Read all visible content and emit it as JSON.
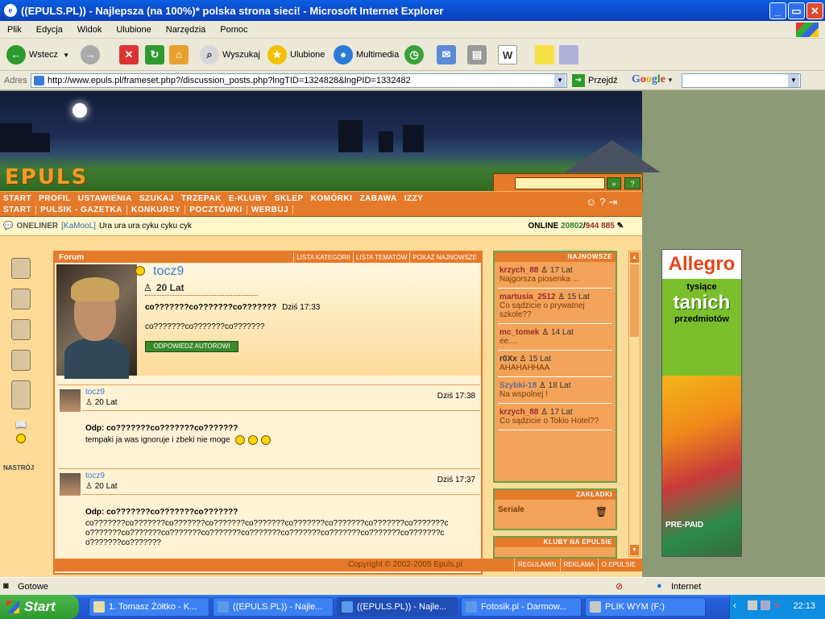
{
  "window": {
    "title": "((EPULS.PL)) - Najlepsza (na 100%)* polska strona sieci! - Microsoft Internet Explorer",
    "minimize": "_",
    "maximize": "▭",
    "close": "✕"
  },
  "menu": [
    "Plik",
    "Edycja",
    "Widok",
    "Ulubione",
    "Narzędzia",
    "Pomoc"
  ],
  "toolbar": {
    "back": "Wstecz",
    "search": "Wyszukaj",
    "favorites": "Ulubione",
    "media": "Multimedia"
  },
  "address": {
    "label": "Adres",
    "url": "http://www.epuls.pl/frameset.php?/discussion_posts.php?lngTID=1324828&lngPID=1332482",
    "go": "Przejdź",
    "google": "Google"
  },
  "site": {
    "logo": "EPULS",
    "nav_row1": [
      "Start",
      "Profil",
      "Ustawienia",
      "Szukaj",
      "Trzepak",
      "E-Kluby",
      "Sklep",
      "Komórki",
      "Zabawa",
      "Izzy"
    ],
    "nav_row2": [
      "Start",
      "Pulsik - Gazetka",
      "Konkursy",
      "Pocztówki",
      "Werbuj"
    ],
    "oneliner_label": "ONELINER",
    "oneliner_nick": "[KaMooL]",
    "oneliner_text": "Ura ura ura cyku cyku cyk",
    "online_label": "ONLINE",
    "online_count": "20802",
    "online_total": "944 885",
    "nastroj": "NASTRÓJ"
  },
  "forum": {
    "title": "Forum",
    "links": [
      "Lista kategorii",
      "Lista tematów",
      "Pokaż najnowsze"
    ],
    "main": {
      "user": "tocz9",
      "age": "20 Lat",
      "subject": "co???????co???????co???????",
      "date": "Dziś 17:33",
      "body": "co???????co???????co???????",
      "reply_btn": "ODPOWIEDZ AUTOROWI"
    },
    "replies": [
      {
        "user": "tocz9",
        "age": "20 Lat",
        "time": "Dziś 17:38",
        "title": "Odp: co???????co???????co???????",
        "body": "tempaki ja was ignoruje i zbeki nie moge"
      },
      {
        "user": "tocz9",
        "age": "20 Lat",
        "time": "Dziś 17:37",
        "title": "Odp: co???????co???????co???????",
        "body": "co???????co???????co???????co???????co???????co???????co???????co???????co???????co???????co???????co???????co???????co???????co???????co???????co???????co???????co???????co???????"
      }
    ],
    "copyright": "Copyright © 2002-2005 Epuls.pl",
    "footer_links": [
      "Regulamin",
      "Reklama",
      "O ePulsie"
    ]
  },
  "sidebar": {
    "newest_title": "NAJNOWSZE",
    "newest": [
      {
        "nick": "krzych_88",
        "age": "17 Lat",
        "text": "Najgorsza piosenka ..."
      },
      {
        "nick": "martusia_2512",
        "age": "15 Lat",
        "text": "Co sądzicie o prywatnej szkole??"
      },
      {
        "nick": "mc_tomek",
        "age": "14 Lat",
        "text": "ee...."
      },
      {
        "nick": "r0Xx",
        "age": "15 Lat",
        "text": "AHAHAHHAA"
      },
      {
        "nick": "Szybki-18",
        "age": "18 Lat",
        "text": "Na wspolnej !"
      },
      {
        "nick": "krzych_88",
        "age": "17 Lat",
        "text": "Co sądzicie o Tokio Hotel??"
      }
    ],
    "bookmarks_title": "ZAKŁADKI",
    "bookmark_item": "Seriale",
    "clubs_title": "KLUBY NA EPULSIE"
  },
  "ad": {
    "brand": "Allegro",
    "line1": "tysiące",
    "line2": "tanich",
    "line3": "przedmiotów",
    "prepaid": "PRE-PAID"
  },
  "status": {
    "left": "Gotowe",
    "zone": "Internet"
  },
  "taskbar": {
    "start": "Start",
    "tasks": [
      "1. Tomasz Żółtko - K...",
      "((EPULS.PL)) - Najle...",
      "((EPULS.PL)) - Najle...",
      "Fotosik.pl - Darmow...",
      "PLIK WYM (F:)"
    ],
    "clock": "22:13"
  }
}
